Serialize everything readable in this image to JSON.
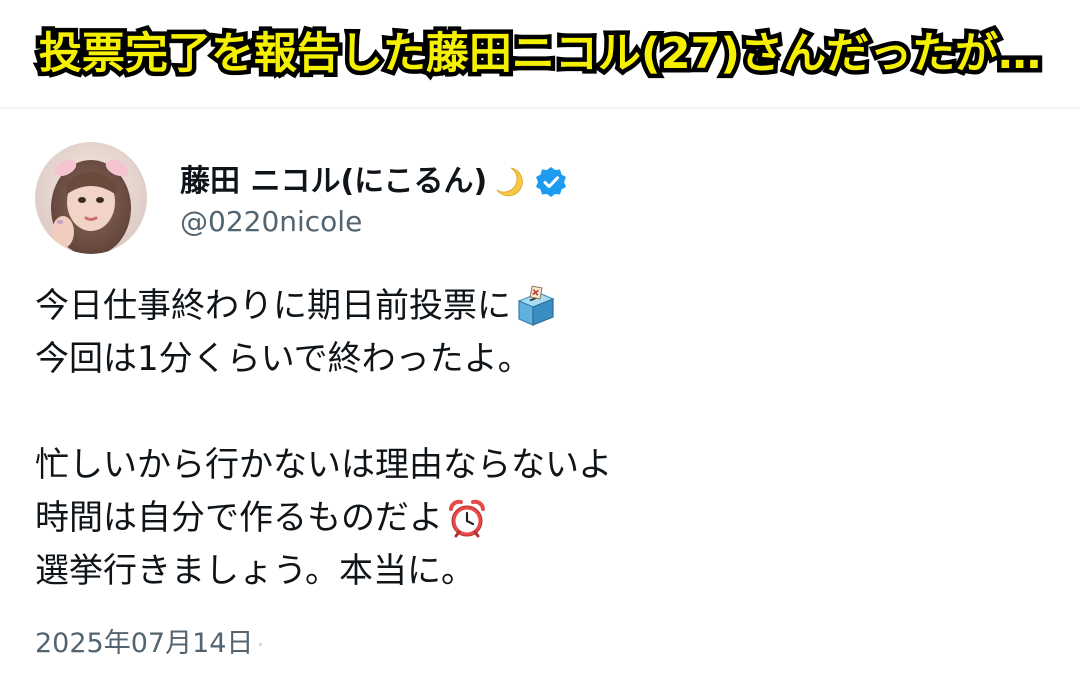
{
  "banner": {
    "text": "投票完了を報告した藤田ニコル(27)さんだったが…"
  },
  "author": {
    "display_name": "藤田 ニコル(にこるん)",
    "handle": "@0220nicole",
    "name_emoji_icon": "crescent-moon-icon",
    "verified_icon": "verified-badge-icon",
    "verified_color": "#1d9bf0"
  },
  "tweet": {
    "lines": [
      "今日仕事終わりに期日前投票に",
      "今回は1分くらいで終わったよ。",
      "",
      "忙しいから行かないは理由ならないよ",
      "時間は自分で作るものだよ",
      "選挙行きましょう。本当に。"
    ],
    "emoji": {
      "line1": "ballot-box-icon",
      "line5": "alarm-clock-icon"
    },
    "timestamp": "2025年07月14日"
  },
  "colors": {
    "banner_fill": "#f5ef00",
    "banner_stroke": "#000000",
    "text_primary": "#0f1419",
    "text_secondary": "#536471"
  }
}
